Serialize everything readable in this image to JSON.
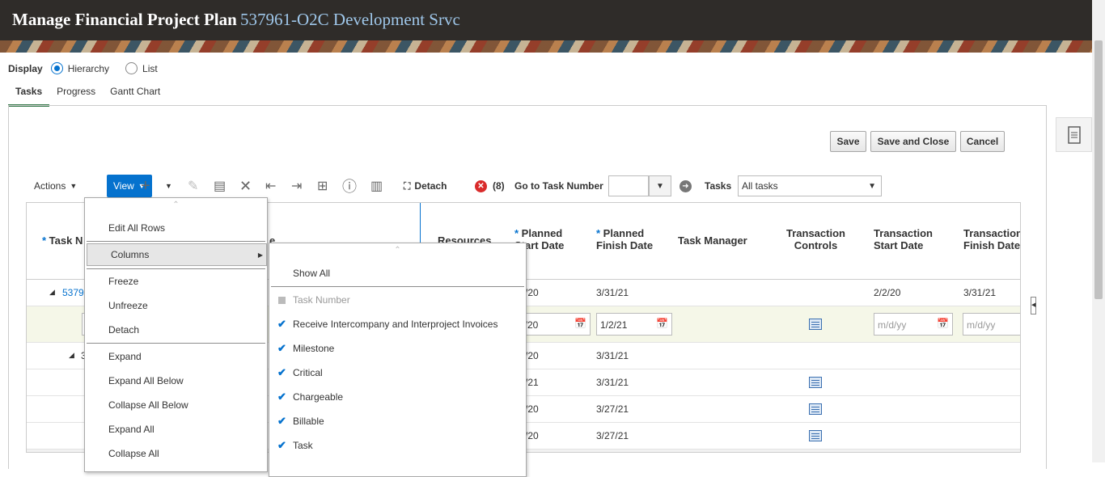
{
  "header": {
    "title": "Manage Financial Project Plan",
    "subtitle": "537961-O2C Development Srvc"
  },
  "display": {
    "label": "Display",
    "options": [
      "Hierarchy",
      "List"
    ],
    "selected": "Hierarchy"
  },
  "tabs": [
    "Tasks",
    "Progress",
    "Gantt Chart"
  ],
  "buttons": {
    "save": "Save",
    "save_close": "Save and Close",
    "cancel": "Cancel"
  },
  "toolbar": {
    "actions": "Actions",
    "view": "View",
    "detach": "Detach",
    "error_count": "(8)",
    "goto_label": "Go to Task Number",
    "tasks_label": "Tasks",
    "tasks_select": "All tasks"
  },
  "columns": {
    "task_number": "Task N",
    "name_frag": "e",
    "resources": "Resources",
    "planned_start_l1": "Planned",
    "planned_start_l2": "Start Date",
    "planned_finish_l1": "Planned",
    "planned_finish_l2": "Finish Date",
    "task_manager": "Task Manager",
    "tc_l1": "Transaction",
    "tc_l2": "Controls",
    "ts_l1": "Transaction",
    "ts_l2": "Start Date",
    "tf_l1": "Transaction",
    "tf_l2": "Finish Date"
  },
  "rows": {
    "r1": {
      "task": "5379",
      "pstart": "/20",
      "pfinish": "3/31/21",
      "tstart": "2/2/20",
      "tfinish": "3/31/21"
    },
    "r2": {
      "pstart": "2/20",
      "pfinish": "1/2/21",
      "tstart_ph": "m/d/yy",
      "tfinish_ph": "m/d/yy"
    },
    "r3": {
      "task": "3",
      "pstart": "/20",
      "pfinish": "3/31/21"
    },
    "r4": {
      "pstart": "/21",
      "pfinish": "3/31/21"
    },
    "r5": {
      "pstart": "/20",
      "pfinish": "3/27/21"
    },
    "r6": {
      "pstart": "/20",
      "pfinish": "3/27/21"
    }
  },
  "view_menu": {
    "items": [
      "Edit All Rows",
      "Columns",
      "Freeze",
      "Unfreeze",
      "Detach",
      "Expand",
      "Expand All Below",
      "Collapse All Below",
      "Expand All",
      "Collapse All"
    ]
  },
  "columns_menu": {
    "show_all": "Show All",
    "items": [
      {
        "label": "Task Number",
        "checked": false,
        "disabled": true
      },
      {
        "label": "Receive Intercompany and Interproject Invoices",
        "checked": true
      },
      {
        "label": "Milestone",
        "checked": true
      },
      {
        "label": "Critical",
        "checked": true
      },
      {
        "label": "Chargeable",
        "checked": true
      },
      {
        "label": "Billable",
        "checked": true
      },
      {
        "label": "Task",
        "checked": true
      }
    ]
  },
  "colors": {
    "accent": "#0572ce",
    "header_bg": "#2f2c29",
    "tab_underline": "#36794a"
  }
}
